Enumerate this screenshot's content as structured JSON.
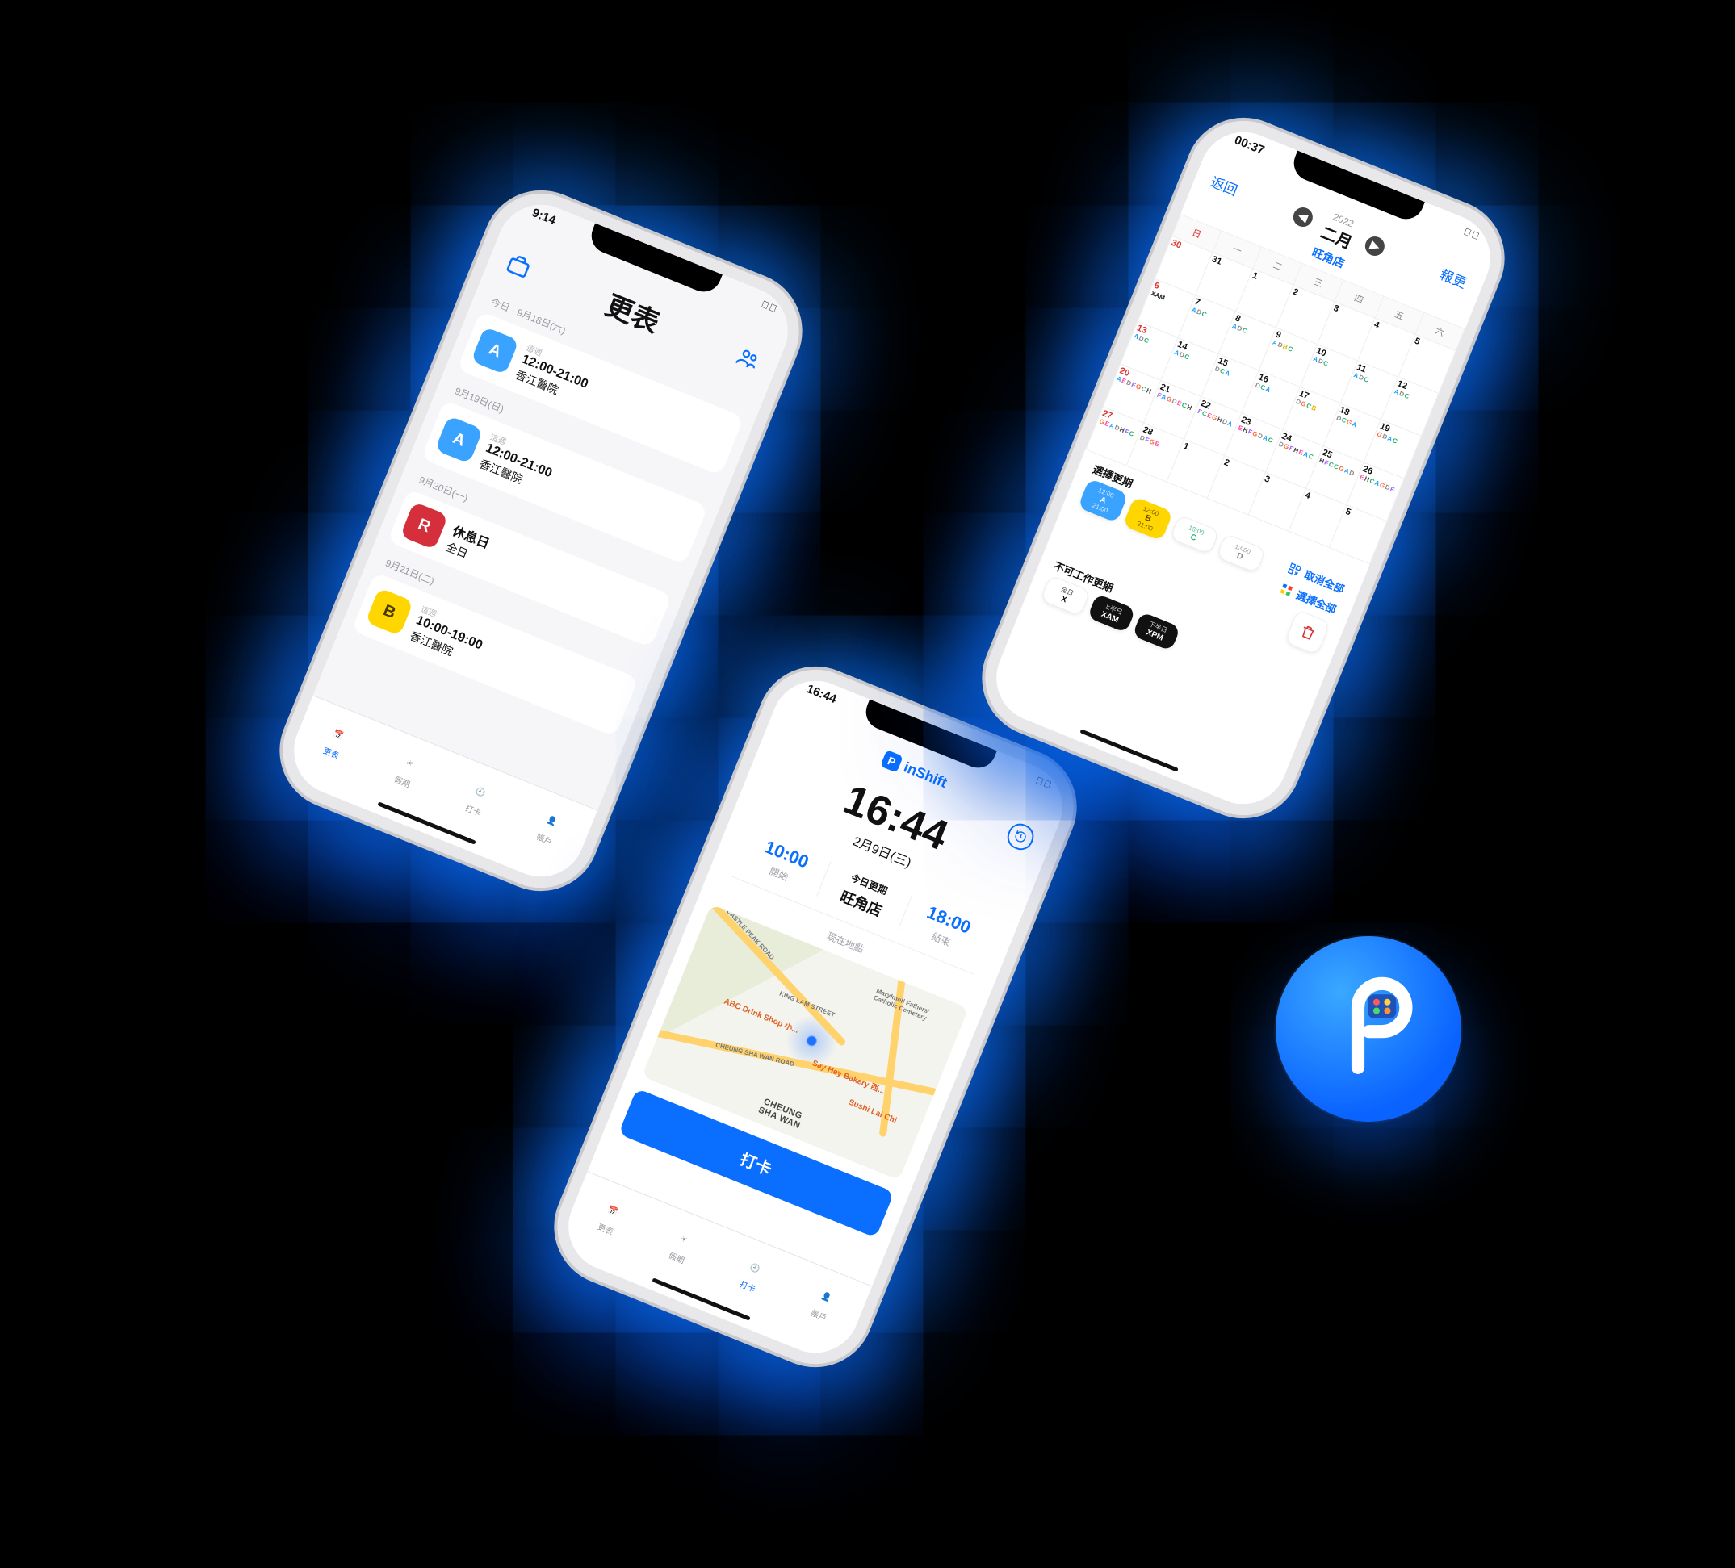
{
  "phone_schedule": {
    "status_time": "9:14",
    "title": "更表",
    "days": [
      {
        "label": "今日 · 9月18日(六)",
        "card": {
          "badge": "A",
          "badge_color": "b-blue",
          "sub": "這週",
          "time": "12:00-21:00",
          "location": "香江醫院"
        }
      },
      {
        "label": "9月19日(日)",
        "card": {
          "badge": "A",
          "badge_color": "b-blue",
          "sub": "這週",
          "time": "12:00-21:00",
          "location": "香江醫院"
        }
      },
      {
        "label": "9月20日(一)",
        "card": {
          "badge": "R",
          "badge_color": "b-red",
          "sub": "",
          "time": "休息日",
          "location": "全日"
        }
      },
      {
        "label": "9月21日(二)",
        "card": {
          "badge": "B",
          "badge_color": "b-yel",
          "sub": "這週",
          "time": "10:00-19:00",
          "location": "香江醫院"
        }
      }
    ],
    "tabs": [
      "更表",
      "假期",
      "打卡",
      "帳戶"
    ]
  },
  "phone_clock": {
    "status_time": "16:44",
    "brand": "inShift",
    "big_time": "16:44",
    "big_date": "2月9日(三)",
    "start_time": "10:00",
    "start_label": "開始",
    "today_shift_label": "今日更期",
    "today_shift_loc": "旺角店",
    "end_time": "18:00",
    "end_label": "結束",
    "loc_now_label": "現在地點",
    "map_labels": {
      "road1": "CASTLE PEAK ROAD",
      "road2": "CHEUNG SHA WAN ROAD",
      "block": "KING LAM STREET",
      "district": "CHEUNG\nSHA WAN",
      "poi1": "Maryknoll Fathers' Catholic Cemetery",
      "pin1": "ABC Drink Shop 小...",
      "pin2": "Say Hey Bakery 西...",
      "pin3": "Sushi Lai Chi"
    },
    "punch_label": "打卡",
    "tabs": [
      "更表",
      "假期",
      "打卡",
      "帳戶"
    ]
  },
  "phone_cal": {
    "status_time": "00:37",
    "back": "返回",
    "report": "報更",
    "year": "2022",
    "month": "二月",
    "sub": "旺角店",
    "dows": [
      "日",
      "一",
      "二",
      "三",
      "四",
      "五",
      "六"
    ],
    "cells": [
      {
        "d": 30,
        "sun": true,
        "t": []
      },
      {
        "d": 31,
        "t": []
      },
      {
        "d": 1,
        "t": []
      },
      {
        "d": 2,
        "t": []
      },
      {
        "d": 3,
        "t": []
      },
      {
        "d": 4,
        "t": []
      },
      {
        "d": 5,
        "t": []
      },
      {
        "d": 6,
        "sun": true,
        "t": [
          "XAM"
        ]
      },
      {
        "d": 7,
        "t": [
          "A",
          "D",
          "C"
        ]
      },
      {
        "d": 8,
        "t": [
          "A",
          "D",
          "C"
        ]
      },
      {
        "d": 9,
        "t": [
          "A",
          "D",
          "B",
          "C"
        ]
      },
      {
        "d": 10,
        "t": [
          "A",
          "D",
          "C"
        ]
      },
      {
        "d": 11,
        "t": [
          "A",
          "D",
          "C"
        ]
      },
      {
        "d": 12,
        "t": [
          "A",
          "D",
          "C"
        ]
      },
      {
        "d": 13,
        "sun": true,
        "t": [
          "A",
          "D",
          "C"
        ]
      },
      {
        "d": 14,
        "t": [
          "A",
          "D",
          "C"
        ]
      },
      {
        "d": 15,
        "t": [
          "D",
          "C",
          "A"
        ]
      },
      {
        "d": 16,
        "t": [
          "D",
          "C",
          "A"
        ]
      },
      {
        "d": 17,
        "t": [
          "D",
          "G",
          "C",
          "B"
        ]
      },
      {
        "d": 18,
        "t": [
          "D",
          "C",
          "G",
          "A"
        ]
      },
      {
        "d": 19,
        "t": [
          "G",
          "D",
          "A",
          "C"
        ]
      },
      {
        "d": 20,
        "sun": true,
        "t": [
          "A",
          "E",
          "D",
          "F",
          "G",
          "C",
          "H"
        ]
      },
      {
        "d": 21,
        "t": [
          "F",
          "A",
          "G",
          "D",
          "E",
          "C",
          "H"
        ]
      },
      {
        "d": 22,
        "t": [
          "F",
          "C",
          "E",
          "G",
          "H",
          "D",
          "A"
        ]
      },
      {
        "d": 23,
        "t": [
          "E",
          "H",
          "F",
          "G",
          "D",
          "A",
          "C"
        ]
      },
      {
        "d": 24,
        "t": [
          "D",
          "G",
          "F",
          "H",
          "E",
          "A",
          "C"
        ]
      },
      {
        "d": 25,
        "t": [
          "H",
          "F",
          "C",
          "C",
          "G",
          "A",
          "D"
        ]
      },
      {
        "d": 26,
        "t": [
          "E",
          "H",
          "C",
          "A",
          "G",
          "D",
          "F"
        ]
      },
      {
        "d": 27,
        "sun": true,
        "t": [
          "G",
          "E",
          "A",
          "D",
          "H",
          "F",
          "C"
        ]
      },
      {
        "d": 28,
        "t": [
          "D",
          "F",
          "G",
          "E"
        ]
      },
      {
        "d": 1,
        "t": []
      },
      {
        "d": 2,
        "t": []
      },
      {
        "d": 3,
        "t": []
      },
      {
        "d": 4,
        "t": []
      },
      {
        "d": 5,
        "t": []
      }
    ],
    "choose_label": "選擇更期",
    "avoid_label": "不可工作更期",
    "shift_chips": [
      {
        "id": "A",
        "cls": "ch-a",
        "t1": "12:00",
        "t2": "21:00"
      },
      {
        "id": "B",
        "cls": "ch-b",
        "t1": "12:00",
        "t2": "21:00"
      },
      {
        "id": "C",
        "cls": "ch-c",
        "t1": "18:00",
        "t2": ""
      },
      {
        "id": "D",
        "cls": "ch-d",
        "t1": "13:00",
        "t2": ""
      }
    ],
    "avoid_chips": [
      {
        "id": "X",
        "cls": "ch-x",
        "t1": "全日",
        "t2": ""
      },
      {
        "id": "XAM",
        "cls": "ch-xam",
        "t1": "上半日",
        "t2": ""
      },
      {
        "id": "XPM",
        "cls": "ch-xpm",
        "t1": "下半日",
        "t2": ""
      }
    ],
    "cancel_all": "取消全部",
    "select_all": "選擇全部"
  }
}
